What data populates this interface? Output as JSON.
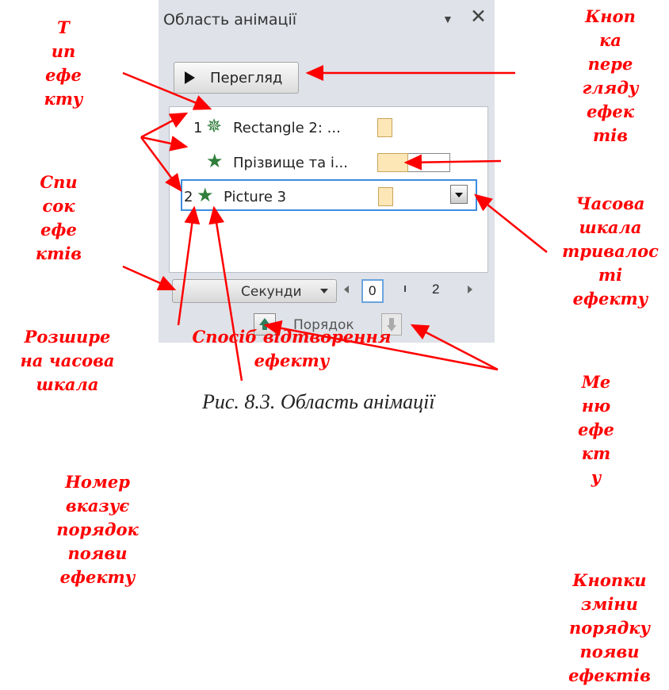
{
  "pane": {
    "title": "Область анімації",
    "menu_icon": "▼",
    "close_icon": "✕",
    "play_button": "Перегляд",
    "effects": [
      {
        "number": "1",
        "name": "Rectangle 2: ...",
        "icon": "star-entrance-icon"
      },
      {
        "number": "",
        "name": "Прізвище та і...",
        "icon": "star-effect-icon"
      },
      {
        "number": "2",
        "name": "Picture 3",
        "icon": "star-effect-icon"
      }
    ],
    "timeline": {
      "seconds_label": "Секунди",
      "value_zero": "0",
      "value_two": "2"
    },
    "order_label": "Порядок"
  },
  "annotations": {
    "effect_type": "Т\nип\nефе\nкту",
    "play_button": "Кноп\nка\nпере\nгляду\nефек\nтів",
    "effect_list": "Спи\nсок\nефе\nктів",
    "timeline": "Часова\nшкала\nтривалос\nті\nефекту",
    "extended_timeline": "Розшире\nна часова\nшкала",
    "playback_method": "Спосіб відтворення\nефекту",
    "effect_menu": "Ме\nню\nефе\nкт\nу",
    "order_number": "Номер\nвказує\nпорядок\nпояви\nефекту",
    "order_buttons": "Кнопки\nзміни\nпорядку\nпояви\nефектів"
  },
  "caption": "Рис. 8.3. Область анімації",
  "colors": {
    "annotation": "#ff0000",
    "pane_bg": "#dfe2e8",
    "timing_bar": "#fde7b6",
    "selection": "#3d8de0"
  }
}
